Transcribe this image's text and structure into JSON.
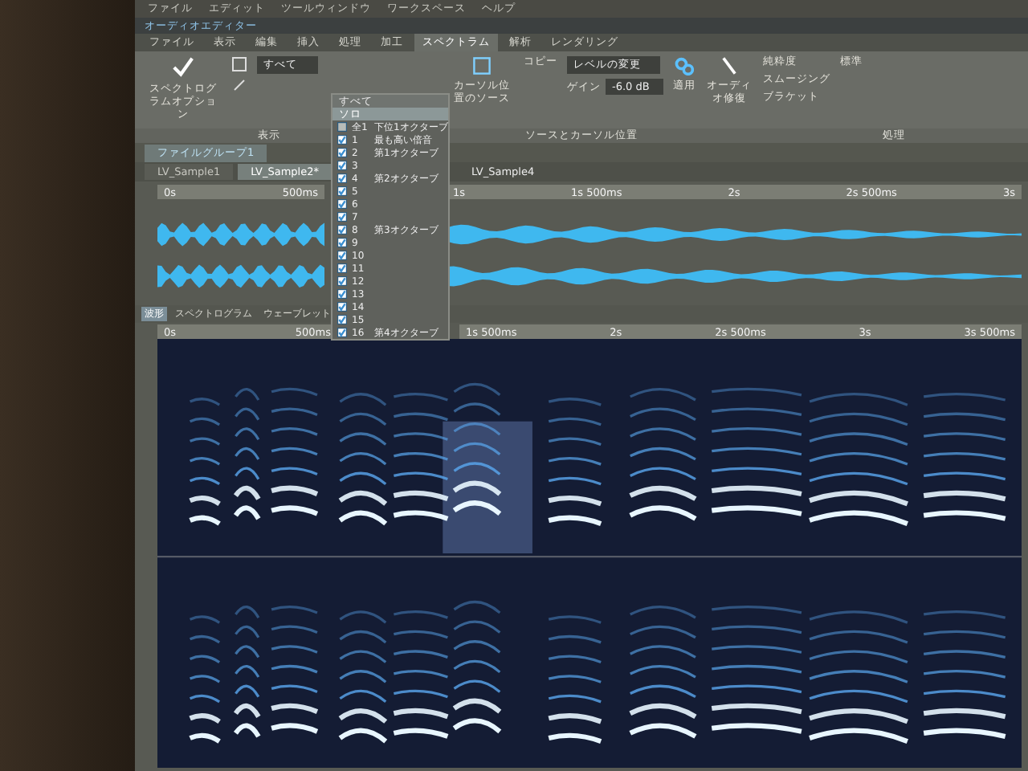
{
  "menu_bar": [
    "ファイル",
    "エディット",
    "ツールウィンドウ",
    "ワークスペース",
    "ヘルプ"
  ],
  "window": {
    "title": "オーディオエディター"
  },
  "ribbon_tabs": [
    {
      "label": "ファイル",
      "selected": false
    },
    {
      "label": "表示",
      "selected": false
    },
    {
      "label": "編集",
      "selected": false
    },
    {
      "label": "挿入",
      "selected": false
    },
    {
      "label": "処理",
      "selected": false
    },
    {
      "label": "加工",
      "selected": false
    },
    {
      "label": "スペクトラム",
      "selected": true
    },
    {
      "label": "解析",
      "selected": false
    },
    {
      "label": "レンダリング",
      "selected": false
    }
  ],
  "ribbon": {
    "options_button": "スペクトログラムオプション",
    "filter_field": "すべて",
    "source_button": "カーソル位置のソース",
    "copy_button": "コピー",
    "level_select": "レベルの変更",
    "gain_label": "ゲイン",
    "gain_value": "-6.0 dB",
    "apply_button": "適用",
    "repair_button": "オーディオ修復",
    "side_items": [
      "純粋度",
      "スムージング",
      "ブラケット"
    ],
    "standard_option": "標準",
    "group_labels": [
      "表示",
      "ソースとカーソル位置",
      "処理"
    ]
  },
  "dropdown": {
    "header": "すべて",
    "hover": "ソロ",
    "items": [
      {
        "number": "全1",
        "label": "下位1オクターブ",
        "checked": false
      },
      {
        "number": "1",
        "label": "最も高い倍音",
        "checked": true
      },
      {
        "number": "2",
        "label": "第1オクターブ",
        "checked": true
      },
      {
        "number": "3",
        "checked": true
      },
      {
        "number": "4",
        "label": "第2オクターブ",
        "checked": true
      },
      {
        "number": "5",
        "checked": true
      },
      {
        "number": "6",
        "checked": true
      },
      {
        "number": "7",
        "checked": true
      },
      {
        "number": "8",
        "label": "第3オクターブ",
        "checked": true
      },
      {
        "number": "9",
        "checked": true
      },
      {
        "number": "10",
        "checked": true
      },
      {
        "number": "11",
        "checked": true
      },
      {
        "number": "12",
        "checked": true
      },
      {
        "number": "13",
        "checked": true
      },
      {
        "number": "14",
        "checked": true
      },
      {
        "number": "15",
        "checked": true
      },
      {
        "number": "16",
        "label": "第4オクターブ",
        "checked": true
      }
    ]
  },
  "file_group": {
    "label": "ファイルグループ1"
  },
  "file_tabs": [
    {
      "label": "LV_Sample1",
      "selected": false
    },
    {
      "label": "LV_Sample2*",
      "selected": true
    }
  ],
  "overview": {
    "title": "LV_Sample4",
    "left_ruler": [
      "0s",
      "500ms"
    ],
    "right_ruler": [
      "1s",
      "1s 500ms",
      "2s",
      "2s 500ms",
      "3s"
    ]
  },
  "view_tabs": [
    {
      "label": "波形",
      "selected": true
    },
    {
      "label": "スペクトログラム",
      "selected": false
    },
    {
      "label": "ウェーブレット",
      "selected": false
    }
  ],
  "main_ruler": {
    "left": [
      "0s",
      "500ms"
    ],
    "right": [
      "1s 500ms",
      "2s",
      "2s 500ms",
      "3s",
      "3s 500ms"
    ]
  }
}
